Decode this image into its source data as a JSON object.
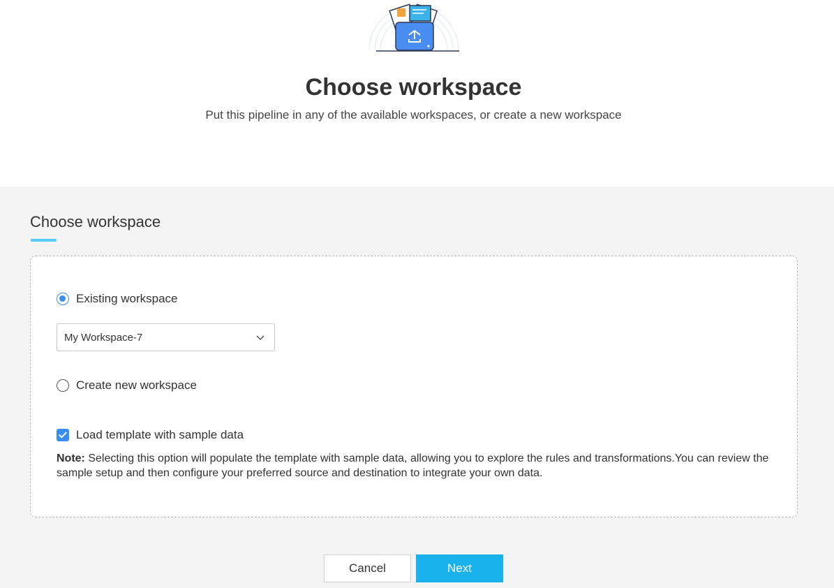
{
  "header": {
    "title": "Choose workspace",
    "subtitle": "Put this pipeline in any of the available workspaces, or create a new workspace",
    "illustration": "folder-upload-illustration"
  },
  "section": {
    "title": "Choose workspace"
  },
  "options": {
    "existing_label": "Existing workspace",
    "existing_selected": true,
    "workspace_select_value": "My Workspace-7",
    "create_label": "Create new workspace",
    "create_selected": false
  },
  "template": {
    "checkbox_label": "Load template with sample data",
    "checked": true,
    "note_prefix": "Note:",
    "note_text": " Selecting this option will populate the template with sample data, allowing you to explore the rules and transformations.You can review the sample setup and then configure your preferred source and destination to integrate your own data."
  },
  "buttons": {
    "cancel": "Cancel",
    "next": "Next"
  },
  "colors": {
    "accent": "#3b8ef0",
    "primary_button": "#1ab2ec",
    "underline": "#5bc8f5"
  }
}
